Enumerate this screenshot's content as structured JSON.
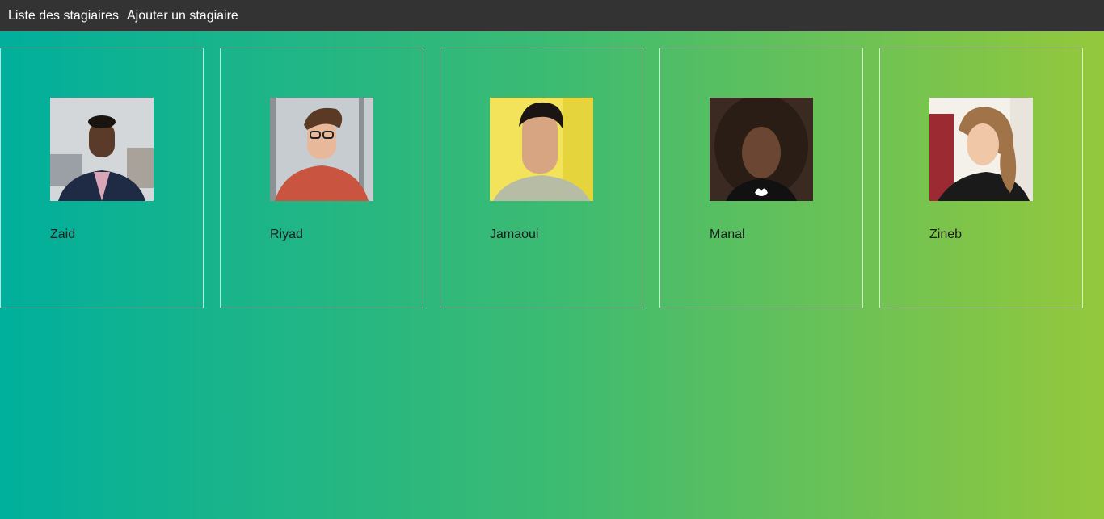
{
  "nav": {
    "list_label": "Liste des stagiaires",
    "add_label": "Ajouter un stagiaire"
  },
  "trainees": [
    {
      "name": "Zaid"
    },
    {
      "name": "Riyad"
    },
    {
      "name": "Jamaoui"
    },
    {
      "name": "Manal"
    },
    {
      "name": "Zineb"
    }
  ]
}
